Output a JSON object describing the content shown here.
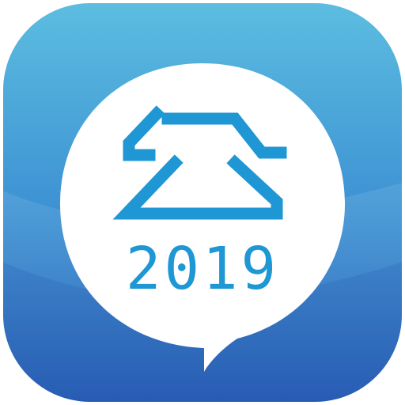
{
  "app_icon": {
    "glyph": "公",
    "year": "2019",
    "colors": {
      "tile_top": "#5cbde0",
      "tile_bottom": "#2a63b8",
      "bubble": "#ffffff",
      "glyph": "#1e97d4",
      "year_text": "#1e97d4"
    }
  }
}
